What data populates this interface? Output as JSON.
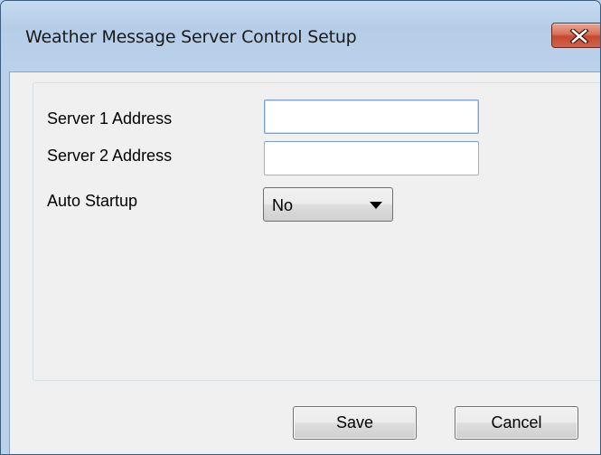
{
  "window": {
    "title": "Weather Message Server Control Setup",
    "close_icon": "close-icon"
  },
  "form": {
    "server1": {
      "label": "Server 1 Address",
      "value": ""
    },
    "server2": {
      "label": "Server 2 Address",
      "value": ""
    },
    "auto_startup": {
      "label": "Auto Startup",
      "selected": "No",
      "icon": "dropdown-arrow-icon"
    }
  },
  "buttons": {
    "save": "Save",
    "cancel": "Cancel"
  },
  "colors": {
    "titlebar": "#b9d1ea",
    "client_background": "#f0f0f0",
    "close_button": "#c4492f",
    "focus_border": "#7da2ce"
  }
}
